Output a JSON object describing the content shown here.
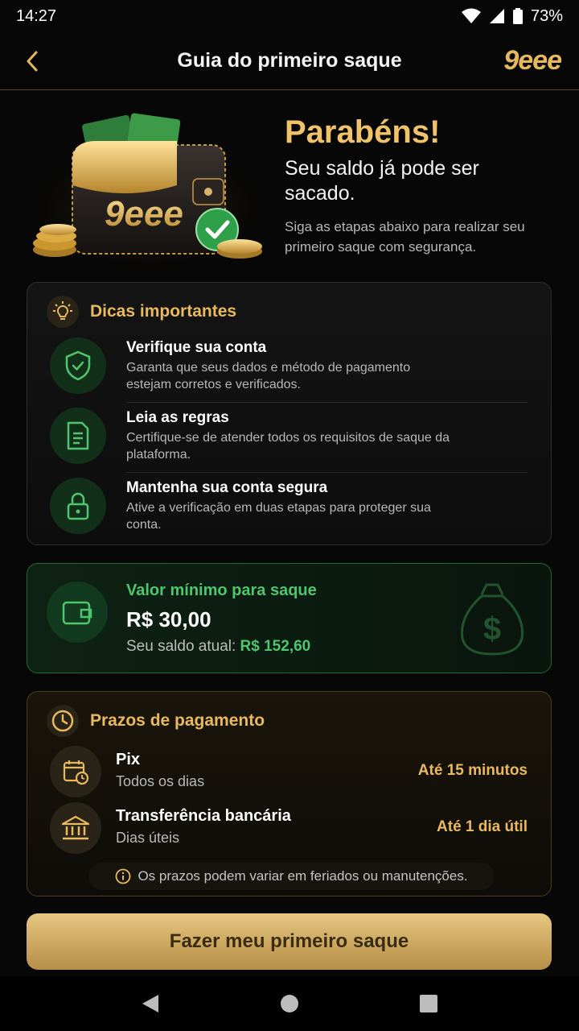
{
  "status": {
    "time": "14:27",
    "battery": "73%"
  },
  "header": {
    "title": "Guia do primeiro saque",
    "logo": "9eee"
  },
  "hero": {
    "title": "Parabéns!",
    "subtitle": "Seu saldo já pode ser sacado.",
    "description": "Siga as etapas abaixo para realizar seu primeiro saque com segurança.",
    "wallet_brand": "9eee"
  },
  "tips": {
    "title": "Dicas importantes",
    "items": [
      {
        "icon": "shield-check-icon",
        "title": "Verifique sua conta",
        "description": "Garanta que seus dados e método de pagamento estejam corretos e verificados."
      },
      {
        "icon": "document-icon",
        "title": "Leia as regras",
        "description": "Certifique-se de atender todos os requisitos de saque da plataforma."
      },
      {
        "icon": "lock-icon",
        "title": "Mantenha sua conta segura",
        "description": "Ative a verificação em duas etapas para proteger sua conta."
      }
    ]
  },
  "minimum": {
    "label": "Valor mínimo para saque",
    "value": "R$ 30,00",
    "balance_label": "Seu saldo atual:",
    "balance_value": "R$ 152,60"
  },
  "deadlines": {
    "title": "Prazos de pagamento",
    "rows": [
      {
        "icon": "calendar-clock-icon",
        "title": "Pix",
        "subtitle": "Todos os dias",
        "time": "Até 15 minutos"
      },
      {
        "icon": "bank-icon",
        "title": "Transferência bancária",
        "subtitle": "Dias úteis",
        "time": "Até 1 dia útil"
      }
    ],
    "note": "Os prazos podem variar em feriados ou manutenções."
  },
  "cta": {
    "label": "Fazer meu primeiro saque"
  },
  "colors": {
    "gold": "#e9b95f",
    "green": "#4fc66e",
    "background": "#070707"
  }
}
